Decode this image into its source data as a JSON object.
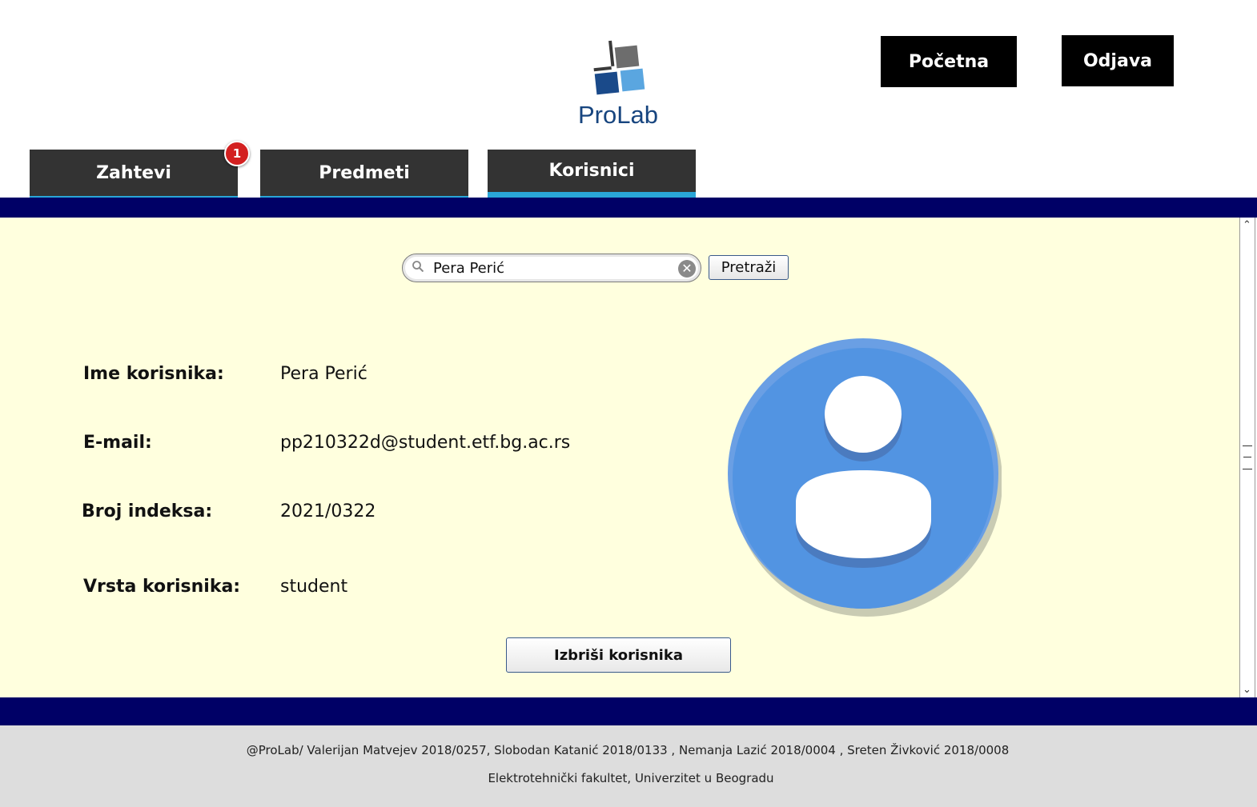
{
  "header": {
    "logo_text": "ProLab",
    "home_label": "Početna",
    "logout_label": "Odjava"
  },
  "tabs": [
    {
      "label": "Zahtevi",
      "badge": "1"
    },
    {
      "label": "Predmeti"
    },
    {
      "label": "Korisnici",
      "active": true
    }
  ],
  "search": {
    "value": "Pera Perić",
    "button_label": "Pretraži"
  },
  "user": {
    "name_label": "Ime korisnika:",
    "name_value": "Pera Perić",
    "email_label": "E-mail:",
    "email_value": "pp210322d@student.etf.bg.ac.rs",
    "index_label": "Broj indeksa:",
    "index_value": "2021/0322",
    "type_label": "Vrsta korisnika:",
    "type_value": "student"
  },
  "delete_label": "Izbriši korisnika",
  "footer": {
    "line1": "@ProLab/ Valerijan Matvejev 2018/0257, Slobodan Katanić 2018/0133 , Nemanja Lazić 2018/0004 , Sreten Živković 2018/0008",
    "line2": "Elektrotehnički fakultet, Univerzitet u Beogradu"
  },
  "colors": {
    "band": "#000066",
    "panel": "#ffffde",
    "tab": "#333333",
    "tab_accent": "#2aa6d8",
    "avatar": "#5294e2"
  }
}
